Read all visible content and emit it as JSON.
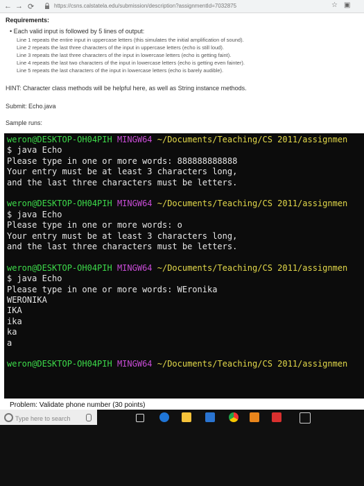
{
  "browser": {
    "url": "https://csns.calstatela.edu/submission/description?assignmentId=7032875"
  },
  "page": {
    "requirements_heading": "Requirements:",
    "bullet": "Each valid input is followed by 5 lines of output:",
    "sub_items": [
      "Line 1 repeats the entire input in uppercase letters (this simulates the initial amplification of sound).",
      "Line 2 repeats the last three characters of the input in uppercase letters (echo is still loud).",
      "Line 3 repeats the last three characters of the input in lowercase letters (echo is getting faint).",
      "Line 4 repeats the last two characters of the input in lowercase letters (echo is getting even fainter).",
      "Line 5 repeats the last characters of the input in lowercase letters (echo is barely audible)."
    ],
    "hint": "HINT: Character class methods will be helpful here, as well as String instance methods.",
    "submit": "Submit: Echo.java",
    "sample_runs": "Sample runs:"
  },
  "terminal": {
    "lines": [
      [
        {
          "t": "weron@DESKTOP-OH04PIH ",
          "c": "g"
        },
        {
          "t": "MINGW64 ",
          "c": "m"
        },
        {
          "t": "~/Documents/Teaching/CS 2011/assignmen",
          "c": "y"
        }
      ],
      [
        {
          "t": "$ java Echo",
          "c": ""
        }
      ],
      [
        {
          "t": "Please type in one or more words: 888888888888",
          "c": ""
        }
      ],
      [
        {
          "t": "Your entry must be at least 3 characters long,",
          "c": ""
        }
      ],
      [
        {
          "t": "and the last three characters must be letters.",
          "c": ""
        }
      ],
      [
        {
          "t": "",
          "c": ""
        }
      ],
      [
        {
          "t": "weron@DESKTOP-OH04PIH ",
          "c": "g"
        },
        {
          "t": "MINGW64 ",
          "c": "m"
        },
        {
          "t": "~/Documents/Teaching/CS 2011/assignmen",
          "c": "y"
        }
      ],
      [
        {
          "t": "$ java Echo",
          "c": ""
        }
      ],
      [
        {
          "t": "Please type in one or more words: o",
          "c": ""
        }
      ],
      [
        {
          "t": "Your entry must be at least 3 characters long,",
          "c": ""
        }
      ],
      [
        {
          "t": "and the last three characters must be letters.",
          "c": ""
        }
      ],
      [
        {
          "t": "",
          "c": ""
        }
      ],
      [
        {
          "t": "weron@DESKTOP-OH04PIH ",
          "c": "g"
        },
        {
          "t": "MINGW64 ",
          "c": "m"
        },
        {
          "t": "~/Documents/Teaching/CS 2011/assignmen",
          "c": "y"
        }
      ],
      [
        {
          "t": "$ java Echo",
          "c": ""
        }
      ],
      [
        {
          "t": "Please type in one or more words: WEronika",
          "c": ""
        }
      ],
      [
        {
          "t": "WERONIKA",
          "c": ""
        }
      ],
      [
        {
          "t": "IKA",
          "c": ""
        }
      ],
      [
        {
          "t": "ika",
          "c": ""
        }
      ],
      [
        {
          "t": "ka",
          "c": ""
        }
      ],
      [
        {
          "t": "a",
          "c": ""
        }
      ],
      [
        {
          "t": "",
          "c": ""
        }
      ],
      [
        {
          "t": "weron@DESKTOP-OH04PIH ",
          "c": "g"
        },
        {
          "t": "MINGW64 ",
          "c": "m"
        },
        {
          "t": "~/Documents/Teaching/CS 2011/assignmen",
          "c": "y"
        }
      ]
    ]
  },
  "problem": "Problem: Validate phone number (30 points)",
  "taskbar": {
    "search_placeholder": "Type here to search"
  }
}
